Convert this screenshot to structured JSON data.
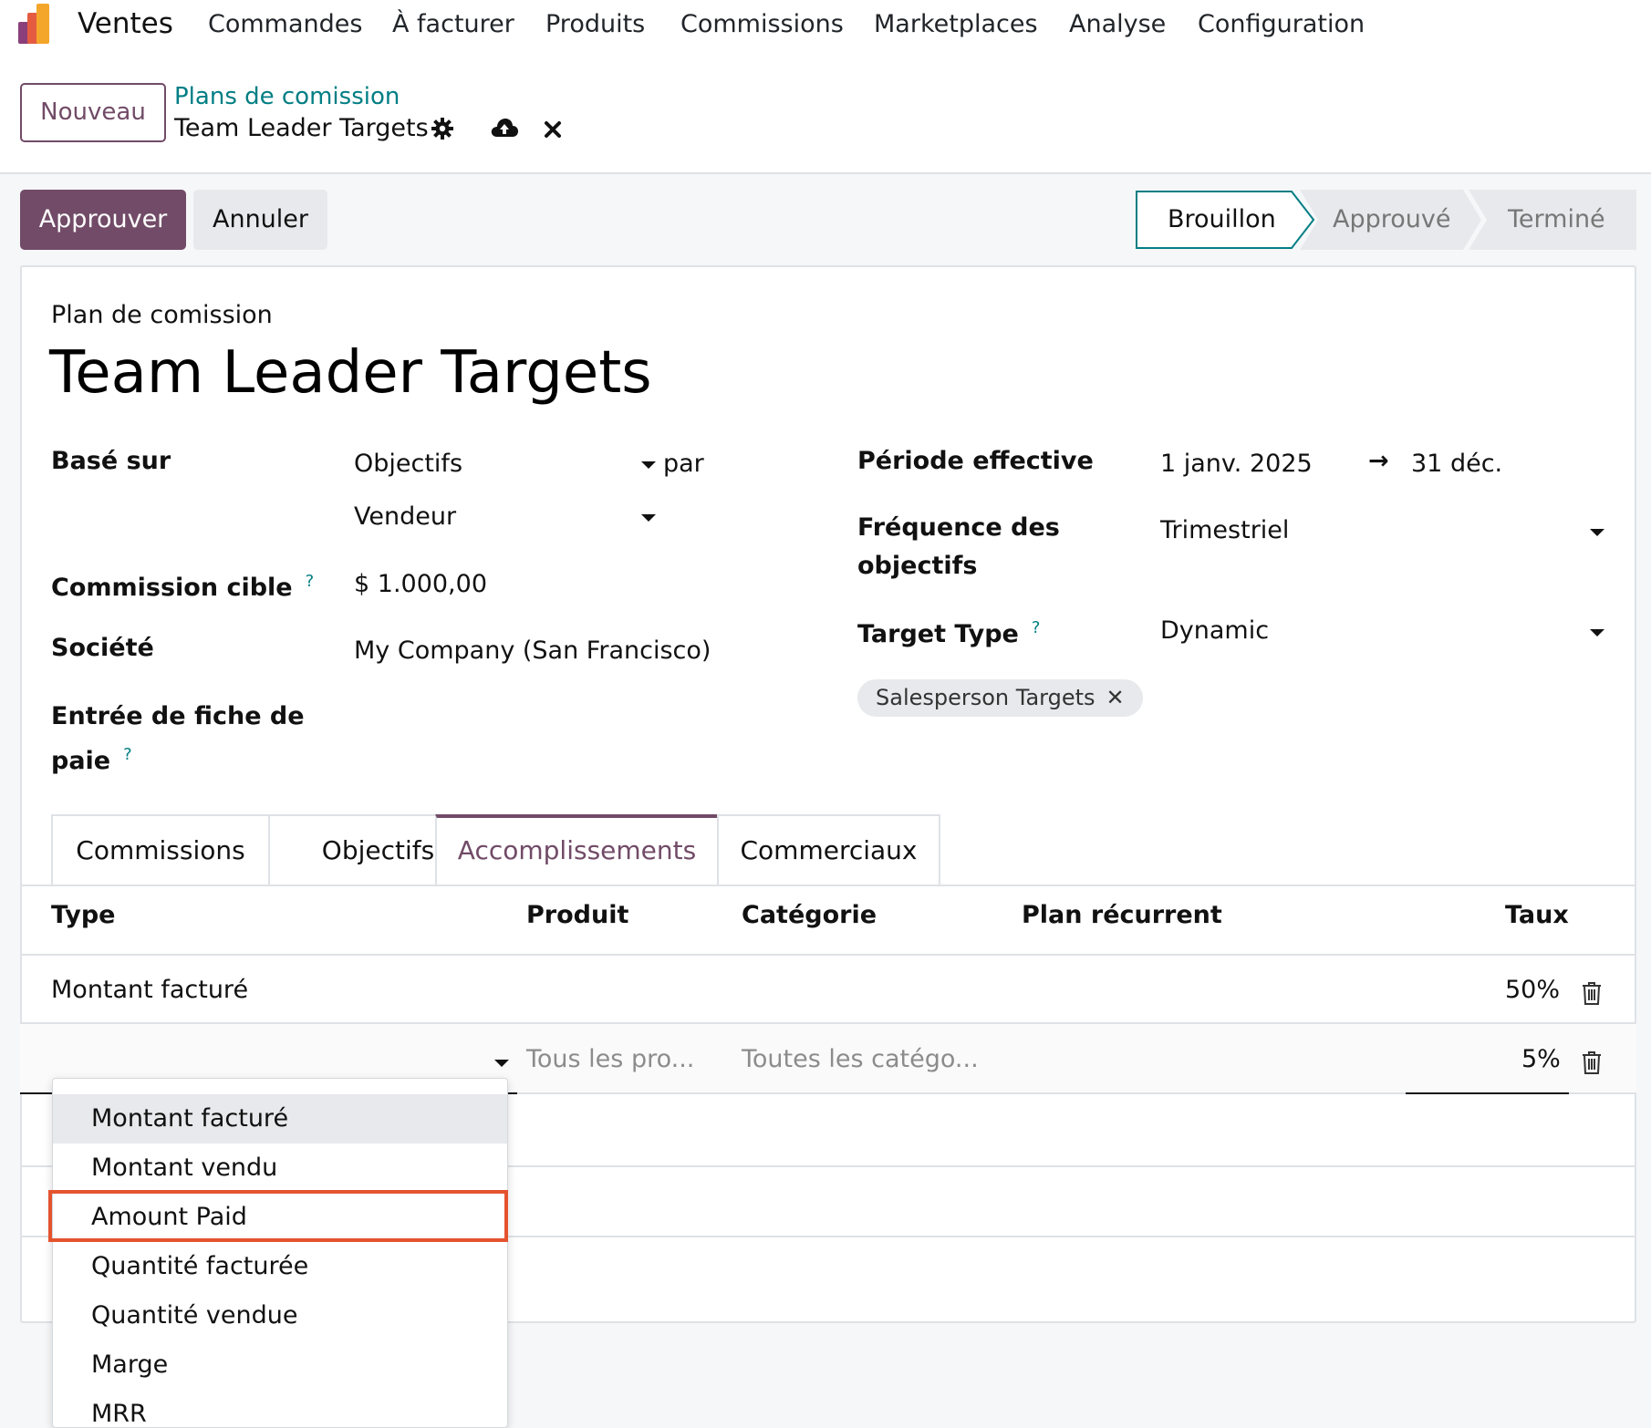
{
  "navbar": {
    "app_name": "Ventes",
    "menu": [
      "Commandes",
      "À facturer",
      "Produits",
      "Commissions",
      "Marketplaces",
      "Analyse",
      "Configuration"
    ]
  },
  "control_panel": {
    "new_button": "Nouveau",
    "breadcrumb_parent": "Plans de comission",
    "breadcrumb_current": "Team Leader Targets"
  },
  "statusbar": {
    "approve_button": "Approuver",
    "cancel_button": "Annuler",
    "stages": [
      "Brouillon",
      "Approuvé",
      "Terminé"
    ],
    "current_stage": "Brouillon"
  },
  "form": {
    "subtitle": "Plan de comission",
    "title": "Team Leader Targets",
    "based_on_label": "Basé sur",
    "based_on_value": "Objectifs",
    "by_text": "par",
    "by_value": "Vendeur",
    "target_commission_label": "Commission cible",
    "target_commission_value": "$ 1.000,00",
    "company_label": "Société",
    "company_value": "My Company (San Francisco)",
    "payslip_label_line1": "Entrée de fiche de",
    "payslip_label_line2": "paie",
    "period_label": "Période effective",
    "period_start": "1 janv. 2025",
    "period_arrow": "→",
    "period_end": "31 déc.",
    "frequency_label_line1": "Fréquence des",
    "frequency_label_line2": "objectifs",
    "frequency_value": "Trimestriel",
    "target_type_label": "Target Type",
    "target_type_value": "Dynamic",
    "tag": "Salesperson Targets",
    "help_mark": "?"
  },
  "tabs": [
    "Commissions",
    "Objectifs",
    "Accomplissements",
    "Commerciaux"
  ],
  "active_tab": "Accomplissements",
  "table": {
    "headers": [
      "Type",
      "Produit",
      "Catégorie",
      "Plan récurrent",
      "Taux"
    ],
    "rows": [
      {
        "type": "Montant facturé",
        "product": "",
        "category": "",
        "recurring": "",
        "rate": "50%"
      }
    ],
    "edit_row": {
      "product_placeholder": "Tous les pro...",
      "category_placeholder": "Toutes les catégo...",
      "rate": "5%"
    }
  },
  "dropdown": {
    "options": [
      "Montant facturé",
      "Montant vendu",
      "Amount Paid",
      "Quantité facturée",
      "Quantité vendue",
      "Marge",
      "MRR"
    ],
    "hovered": "Montant facturé",
    "highlighted": "Amount Paid"
  },
  "colors": {
    "primary": "#714B67",
    "link": "#017e84",
    "highlight": "#e4532e"
  }
}
